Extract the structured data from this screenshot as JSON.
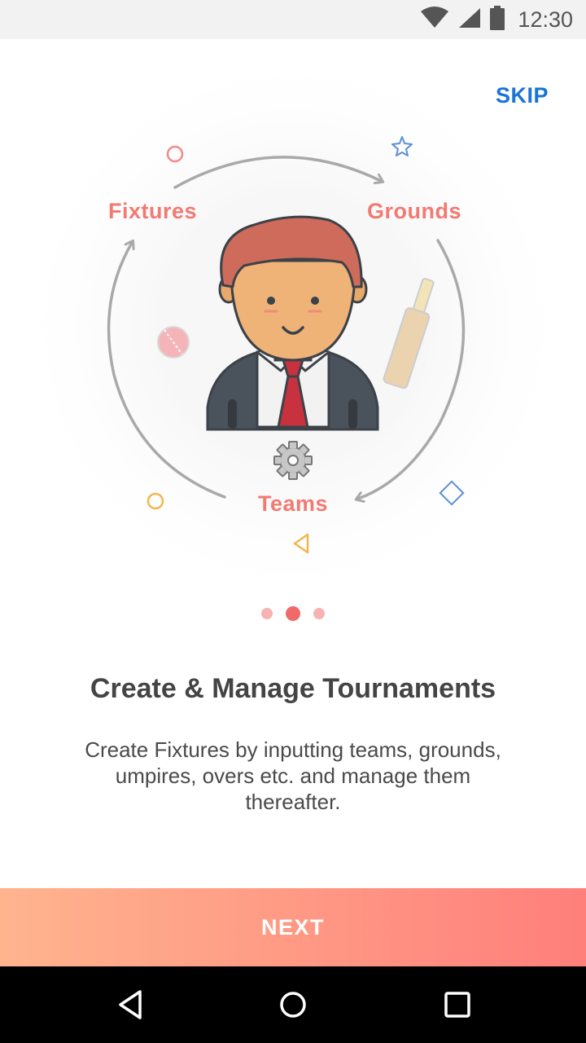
{
  "status_bar": {
    "time": "12:30",
    "icons": [
      "wifi-icon",
      "cell-signal-icon",
      "battery-icon"
    ]
  },
  "skip_label": "SKIP",
  "illustration": {
    "labels": {
      "fixtures": "Fixtures",
      "grounds": "Grounds",
      "teams": "Teams"
    },
    "accent_color": "#f27a72"
  },
  "pagination": {
    "total": 3,
    "active_index": 1
  },
  "title": "Create & Manage Tournaments",
  "description": "Create Fixtures by inputting teams, grounds, umpires, overs etc. and manage them thereafter.",
  "next_button": {
    "label": "NEXT",
    "gradient_start": "#ffb48e",
    "gradient_end": "#ff7f7b"
  },
  "nav_bar": {
    "icons": [
      "back-icon",
      "home-icon",
      "recent-apps-icon"
    ]
  }
}
